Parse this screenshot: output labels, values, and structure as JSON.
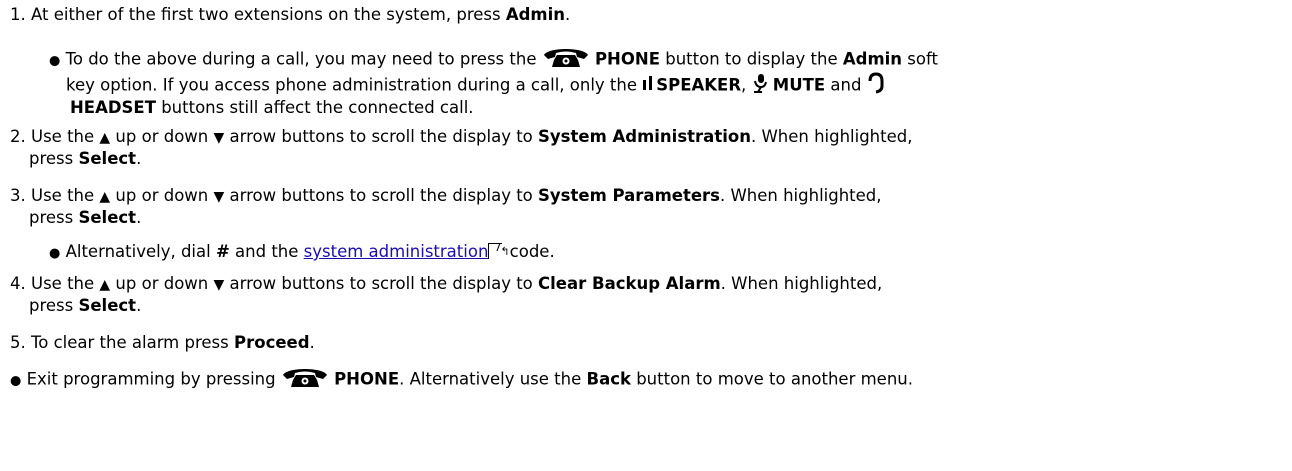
{
  "steps": {
    "s1": {
      "num": "1.",
      "a": "At either of the first two extensions on the system, press ",
      "admin": "Admin",
      "end": "."
    },
    "s1b": {
      "a": "To do the above during a call, you may need to press the ",
      "phone": "PHONE",
      "b": " button to display the ",
      "admin": "Admin",
      "c": " soft",
      "d": "key option. If you access phone administration during a call, only the ",
      "speaker": "SPEAKER",
      "comma": ",",
      "mute": "MUTE",
      "and": " and",
      "headset": "HEADSET",
      "e": " buttons still affect the connected call."
    },
    "s2": {
      "num": "2.",
      "a": "Use the ",
      "b": " up or down ",
      "c": " arrow buttons to scroll the display to ",
      "target": "System Administration",
      "d": ". When highlighted,",
      "e": "press ",
      "select": "Select",
      "end": "."
    },
    "s3": {
      "num": "3.",
      "a": "Use the ",
      "b": " up or down ",
      "c": " arrow buttons to scroll the display to ",
      "target": "System Parameters",
      "d": ". When highlighted,",
      "e": "press ",
      "select": "Select",
      "end": "."
    },
    "s3b": {
      "a": "Alternatively, dial ",
      "hash": "#",
      "b": " and the ",
      "link": "system administration",
      "xref": "7",
      "c": " code."
    },
    "s4": {
      "num": "4.",
      "a": "Use the ",
      "b": " up or down ",
      "c": " arrow buttons to scroll the display to ",
      "target": "Clear Backup Alarm",
      "d": ". When highlighted,",
      "e": "press ",
      "select": "Select",
      "end": "."
    },
    "s5": {
      "num": "5.",
      "a": "To clear the alarm press ",
      "proceed": "Proceed",
      "end": "."
    },
    "exit": {
      "a": "Exit programming by pressing ",
      "phone": "PHONE",
      "b": ". Alternatively use the ",
      "back": "Back",
      "c": " button to move to another menu."
    }
  },
  "glyphs": {
    "up": "▲",
    "down": "▼",
    "bullet": "●"
  },
  "icons": {
    "phone": "phone-icon",
    "speaker": "speaker-icon",
    "mute": "mute-icon",
    "headset": "headset-icon"
  }
}
